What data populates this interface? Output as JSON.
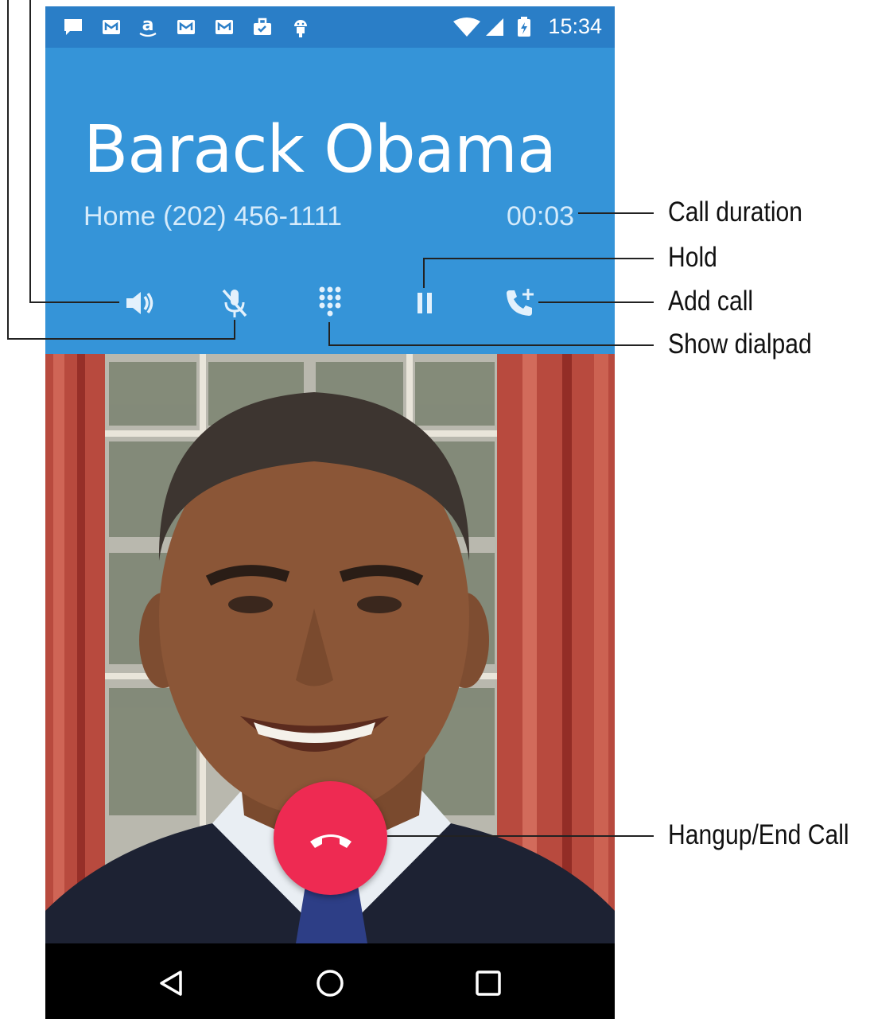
{
  "status_bar": {
    "time": "15:34",
    "notification_icons": [
      "message-icon",
      "gmail-icon",
      "amazon-icon",
      "gmail-icon",
      "gmail-icon",
      "briefcase-check-icon",
      "android-icon"
    ],
    "system_icons": [
      "wifi-icon",
      "cell-signal-icon",
      "battery-charging-icon"
    ]
  },
  "call": {
    "caller_name": "Barack Obama",
    "caller_number": "Home (202) 456-1111",
    "duration": "00:03",
    "buttons": [
      "speaker-icon",
      "mute-icon",
      "dialpad-icon",
      "hold-icon",
      "add-call-icon"
    ]
  },
  "hangup_icon": "phone-hangup-icon",
  "nav_bar": [
    "back-icon",
    "home-icon",
    "recents-icon"
  ],
  "callouts": {
    "call_duration": "Call duration",
    "hold": "Hold",
    "add_call": "Add call",
    "show_dialpad": "Show dialpad",
    "hangup": "Hangup/End Call"
  },
  "colors": {
    "status_bar": "#2a7ec7",
    "header": "#3594d8",
    "hangup": "#ee2a52",
    "nav_bar": "#000000"
  }
}
